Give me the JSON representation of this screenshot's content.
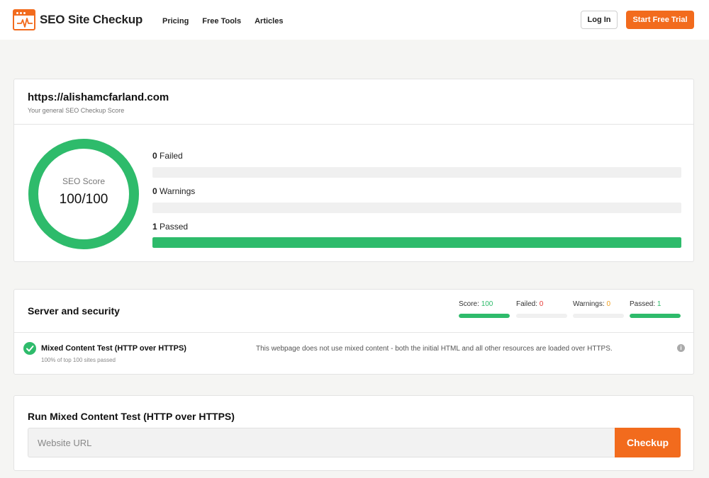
{
  "header": {
    "logo_text": "SEO Site Checkup",
    "nav": [
      "Pricing",
      "Free Tools",
      "Articles"
    ],
    "login_label": "Log In",
    "trial_label": "Start Free Trial",
    "accent_color": "#f26b1d"
  },
  "summary": {
    "url": "https://alishamcfarland.com",
    "subtitle": "Your general SEO Checkup Score",
    "score_label": "SEO Score",
    "score_value": "100/100",
    "score_fraction": 1.0,
    "ring_color": "#2ebb6b",
    "stats": [
      {
        "count": "0",
        "label": "Failed",
        "fraction": 0
      },
      {
        "count": "0",
        "label": "Warnings",
        "fraction": 0
      },
      {
        "count": "1",
        "label": "Passed",
        "fraction": 1
      }
    ]
  },
  "section": {
    "title": "Server and security",
    "scores": [
      {
        "label": "Score:",
        "value": "100",
        "value_color": "#2ebb6b",
        "fraction": 1
      },
      {
        "label": "Failed:",
        "value": "0",
        "value_color": "#e53935",
        "fraction": 0
      },
      {
        "label": "Warnings:",
        "value": "0",
        "value_color": "#f0a020",
        "fraction": 0
      },
      {
        "label": "Passed:",
        "value": "1",
        "value_color": "#2ebb6b",
        "fraction": 1
      }
    ],
    "test": {
      "icon": "check-circle-icon",
      "name": "Mixed Content Test (HTTP over HTTPS)",
      "sub": "100% of top 100 sites passed",
      "description": "This webpage does not use mixed content - both the initial HTML and all other resources are loaded over HTTPS.",
      "info_icon": "info-icon"
    }
  },
  "run": {
    "title": "Run Mixed Content Test (HTTP over HTTPS)",
    "placeholder": "Website URL",
    "button_label": "Checkup"
  }
}
